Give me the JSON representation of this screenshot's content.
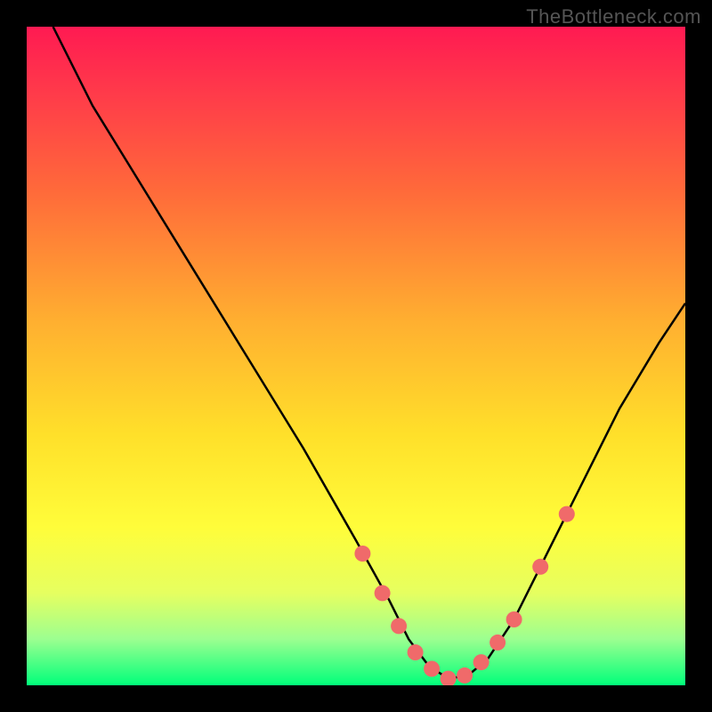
{
  "watermark": "TheBottleneck.com",
  "colors": {
    "page_background": "#000000",
    "curve_stroke": "#000000",
    "point_fill": "#f06a6a",
    "gradient_stops": [
      {
        "pct": 0,
        "hex": "#ff1a52"
      },
      {
        "pct": 10,
        "hex": "#ff3a4a"
      },
      {
        "pct": 25,
        "hex": "#ff6a3a"
      },
      {
        "pct": 45,
        "hex": "#ffb030"
      },
      {
        "pct": 62,
        "hex": "#ffe02a"
      },
      {
        "pct": 76,
        "hex": "#fffd3a"
      },
      {
        "pct": 86,
        "hex": "#e6ff60"
      },
      {
        "pct": 93,
        "hex": "#9cff90"
      },
      {
        "pct": 100,
        "hex": "#00ff7a"
      }
    ]
  },
  "chart_data": {
    "type": "line",
    "title": "",
    "xlabel": "",
    "ylabel": "",
    "xlim": [
      0,
      100
    ],
    "ylim": [
      0,
      100
    ],
    "note": "x and y in percent of plot area; y=0 is bottom (green), y=100 is top (red). Curve is a V-shaped bottleneck profile with minimum near x≈64.",
    "series": [
      {
        "name": "bottleneck-curve",
        "x": [
          4,
          10,
          18,
          26,
          34,
          42,
          50,
          55,
          58,
          61,
          64,
          67,
          70,
          74,
          78,
          84,
          90,
          96,
          100
        ],
        "y": [
          100,
          88,
          75,
          62,
          49,
          36,
          22,
          13,
          7,
          3,
          1,
          1.5,
          4,
          10,
          18,
          30,
          42,
          52,
          58
        ]
      },
      {
        "name": "highlight-points",
        "x": [
          51,
          54,
          56.5,
          59,
          61.5,
          64,
          66.5,
          69,
          71.5,
          74,
          78,
          82
        ],
        "y": [
          20,
          14,
          9,
          5,
          2.5,
          1,
          1.5,
          3.5,
          6.5,
          10,
          18,
          26
        ]
      }
    ]
  }
}
